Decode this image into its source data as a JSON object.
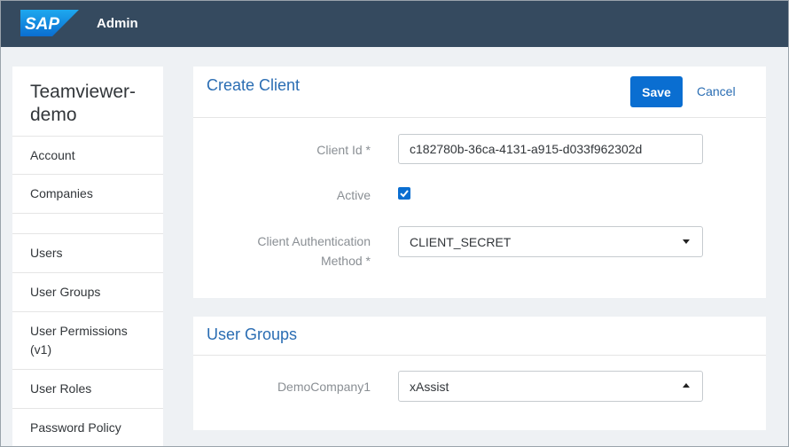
{
  "shell": {
    "logo_text": "SAP",
    "title": "Admin"
  },
  "sidebar": {
    "org_name": "Teamviewer-demo",
    "items": [
      {
        "label": "Account"
      },
      {
        "label": "Companies"
      },
      {
        "label": ""
      },
      {
        "label": "Users"
      },
      {
        "label": "User Groups"
      },
      {
        "label": "User Permissions (v1)"
      },
      {
        "label": "User Roles"
      },
      {
        "label": "Password Policy"
      }
    ]
  },
  "create_client": {
    "title": "Create Client",
    "save_label": "Save",
    "cancel_label": "Cancel",
    "client_id_label": "Client Id *",
    "client_id_value": "c182780b-36ca-4131-a915-d033f962302d",
    "active_label": "Active",
    "active_checked": true,
    "auth_method_label": "Client Authentication Method *",
    "auth_method_value": "CLIENT_SECRET"
  },
  "user_groups": {
    "title": "User Groups",
    "company_label": "DemoCompany1",
    "group_value": "xAssist"
  },
  "colors": {
    "shell_bg": "#354a5f",
    "accent": "#0a6ed1",
    "title_blue": "#2a6db3",
    "page_bg": "#eef1f4"
  }
}
